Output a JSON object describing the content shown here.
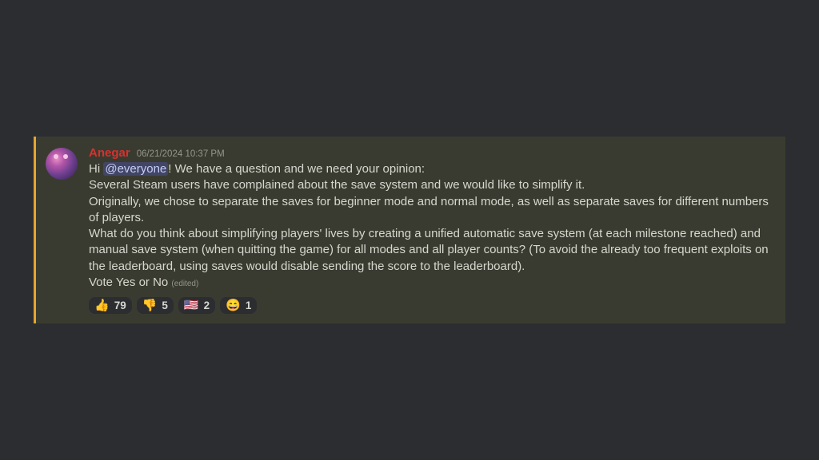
{
  "message": {
    "author": "Anegar",
    "timestamp": "06/21/2024 10:37 PM",
    "greeting_pre": "Hi ",
    "mention": "@everyone",
    "greeting_post": "! We have a question and we need your opinion:",
    "line2": "Several Steam users have complained about the save system and we would like to simplify it.",
    "line3": "Originally, we chose to separate the saves for beginner mode and normal mode, as well as separate saves for different numbers of players.",
    "line4": "What do you think about simplifying players' lives by creating a unified automatic save system (at each milestone reached) and manual save system (when quitting the game) for all modes and all player counts? (To avoid the already too frequent exploits on the leaderboard, using saves would disable sending the score to the leaderboard).",
    "line5": "Vote Yes or No",
    "edited_label": "(edited)"
  },
  "reactions": {
    "r0": {
      "emoji": "👍",
      "count": "79"
    },
    "r1": {
      "emoji": "👎",
      "count": "5"
    },
    "r2": {
      "emoji": "🇺🇸",
      "count": "2"
    },
    "r3": {
      "emoji": "😄",
      "count": "1"
    }
  }
}
